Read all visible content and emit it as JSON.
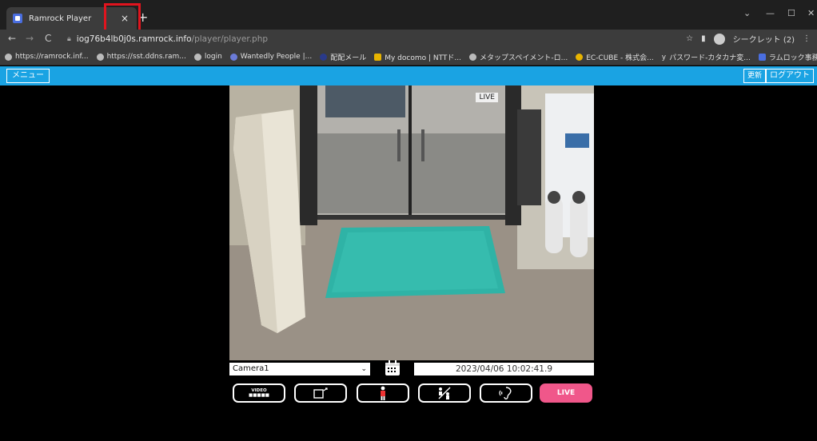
{
  "browser": {
    "tab_title": "Ramrock Player",
    "tab_close": "×",
    "new_tab": "+",
    "url_host": "iog76b4lb0j0s.ramrock.info",
    "url_path": "/player/player.php",
    "incognito_label": "シークレット (2)",
    "bookmarks": [
      "https://ramrock.inf...",
      "https://sst.ddns.ram...",
      "login",
      "Wantedly People |...",
      "配配メール",
      "My docomo | NTTド...",
      "メタップスペイメント-ロ...",
      "EC-CUBE - 株式会...",
      "パスワード-カタカナ変...",
      "ラムロック事務所"
    ]
  },
  "app": {
    "menu_label": "メニュー",
    "refresh_label": "更新",
    "logout_label": "ログアウト"
  },
  "player": {
    "live_overlay": "LIVE",
    "camera_selected": "Camera1",
    "datetime": "2023/04/06 10:02:41.9",
    "buttons": {
      "video_line1": "VIDEO",
      "video_line2": "■■■■■",
      "live": "LIVE"
    }
  },
  "colors": {
    "appbar": "#1aa3e3",
    "live_button": "#f0578a",
    "highlight": "#e0141e"
  }
}
